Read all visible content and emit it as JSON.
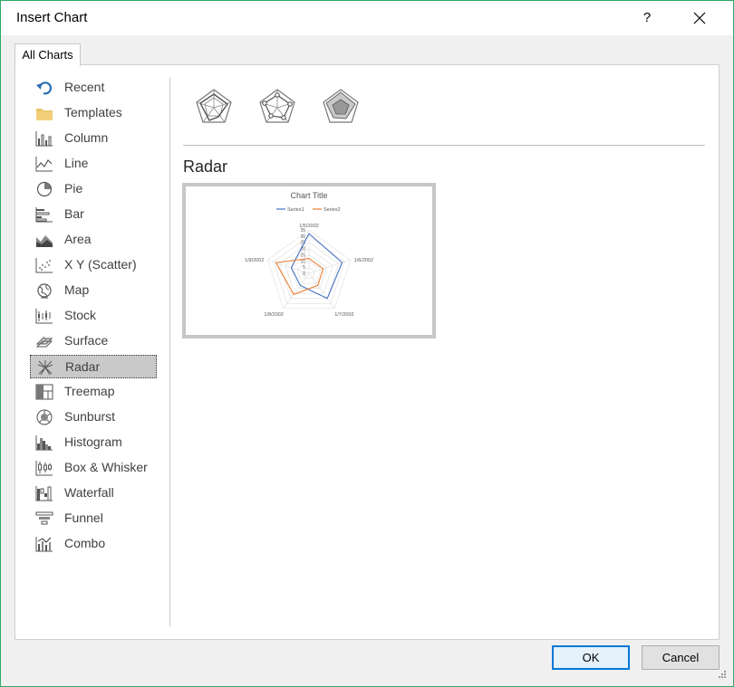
{
  "window": {
    "title": "Insert Chart",
    "help_label": "?"
  },
  "tabs": [
    {
      "label": "All Charts"
    }
  ],
  "chart_types": [
    {
      "label": "Recent",
      "icon": "recent-icon"
    },
    {
      "label": "Templates",
      "icon": "folder-icon"
    },
    {
      "label": "Column",
      "icon": "column-chart-icon"
    },
    {
      "label": "Line",
      "icon": "line-chart-icon"
    },
    {
      "label": "Pie",
      "icon": "pie-chart-icon"
    },
    {
      "label": "Bar",
      "icon": "bar-chart-icon"
    },
    {
      "label": "Area",
      "icon": "area-chart-icon"
    },
    {
      "label": "X Y (Scatter)",
      "icon": "scatter-chart-icon"
    },
    {
      "label": "Map",
      "icon": "map-chart-icon"
    },
    {
      "label": "Stock",
      "icon": "stock-chart-icon"
    },
    {
      "label": "Surface",
      "icon": "surface-chart-icon"
    },
    {
      "label": "Radar",
      "icon": "radar-chart-icon",
      "selected": true
    },
    {
      "label": "Treemap",
      "icon": "treemap-chart-icon"
    },
    {
      "label": "Sunburst",
      "icon": "sunburst-chart-icon"
    },
    {
      "label": "Histogram",
      "icon": "histogram-chart-icon"
    },
    {
      "label": "Box & Whisker",
      "icon": "box-whisker-chart-icon"
    },
    {
      "label": "Waterfall",
      "icon": "waterfall-chart-icon"
    },
    {
      "label": "Funnel",
      "icon": "funnel-chart-icon"
    },
    {
      "label": "Combo",
      "icon": "combo-chart-icon"
    }
  ],
  "subtypes": [
    {
      "icon": "radar-subtype-icon",
      "selected": true
    },
    {
      "icon": "radar-markers-subtype-icon",
      "selected": false
    },
    {
      "icon": "filled-radar-subtype-icon",
      "selected": false
    }
  ],
  "preview": {
    "title": "Radar"
  },
  "chart_data": {
    "type": "radar",
    "title": "Chart Title",
    "categories": [
      "1/5/2002",
      "1/6/2002",
      "1/7/2002",
      "1/8/2002",
      "1/9/2002"
    ],
    "series": [
      {
        "name": "Series1",
        "values": [
          32,
          28,
          25,
          12,
          15
        ],
        "color": "#4472c4"
      },
      {
        "name": "Series2",
        "values": [
          12,
          12,
          12,
          21,
          28
        ],
        "color": "#ed7d31"
      }
    ],
    "axis_ticks": [
      "0",
      "5",
      "10",
      "15",
      "20",
      "25",
      "30",
      "35"
    ],
    "rmax": 35,
    "legend_position": "top"
  },
  "buttons": {
    "ok": "OK",
    "cancel": "Cancel"
  },
  "colors": {
    "accent": "#0078d7",
    "selection": "#c9c9c9",
    "window_border": "#2fa86a"
  }
}
